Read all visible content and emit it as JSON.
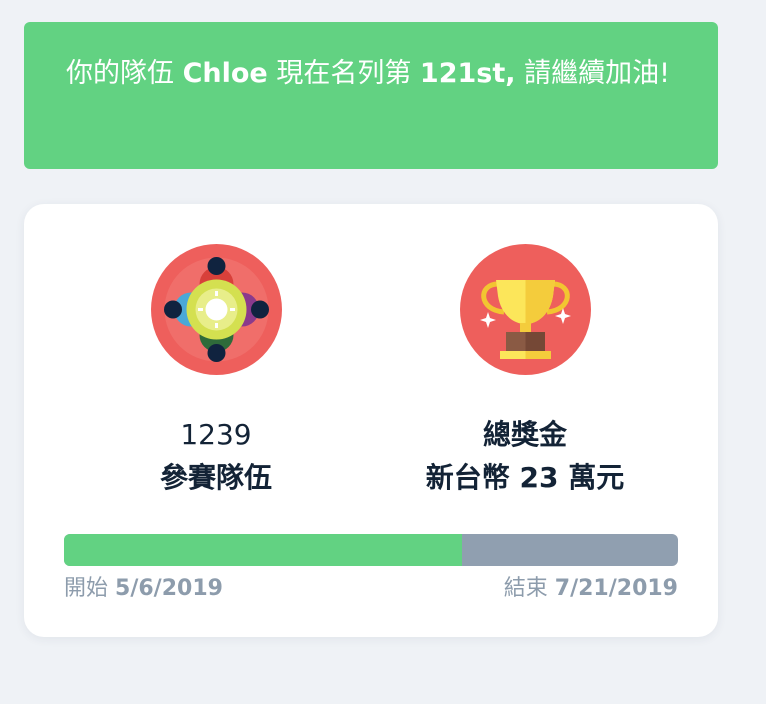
{
  "banner": {
    "prefix": "你的隊伍 ",
    "team": "Chloe",
    "middle": " 現在名列第 ",
    "rank": "121st,",
    "suffix": " 請繼續加油!"
  },
  "stats": {
    "teams": {
      "icon": "team-circle-icon",
      "count": "1239",
      "label": "參賽隊伍"
    },
    "prize": {
      "icon": "trophy-icon",
      "label": "總獎金",
      "amount": "新台幣 23 萬元"
    }
  },
  "progress": {
    "fraction": 0.648,
    "start_label": "開始",
    "start_date": "5/6/2019",
    "end_label": "結束",
    "end_date": "7/21/2019"
  },
  "colors": {
    "accent_green": "#62d282",
    "progress_remaining": "#909fb0",
    "badge_red": "#ee5f5c",
    "text_dark": "#132336",
    "text_muted": "#8d9cac"
  }
}
